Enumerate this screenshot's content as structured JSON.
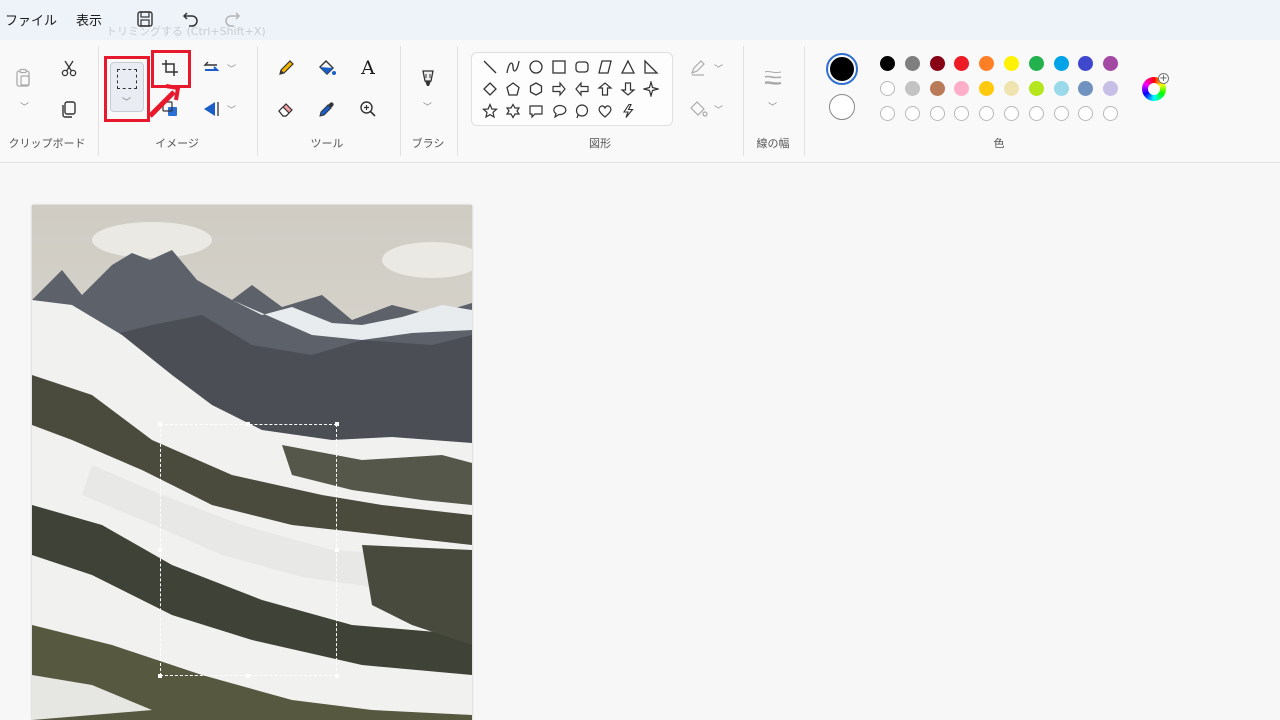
{
  "menu": {
    "file": "ファイル",
    "view": "表示"
  },
  "tooltip": "トリミングする (Ctrl+Shift+X)",
  "groups": {
    "clipboard": "クリップボード",
    "image": "イメージ",
    "tools": "ツール",
    "brushes": "ブラシ",
    "shapes": "図形",
    "line_width": "線の幅",
    "colors": "色"
  },
  "text_tool_glyph": "A",
  "palette": {
    "row1": [
      "#000000",
      "#7f7f7f",
      "#880015",
      "#ed1c24",
      "#ff7f27",
      "#fff200",
      "#22b14c",
      "#00a2e8",
      "#3f48cc",
      "#a349a4"
    ],
    "row2": [
      "#ffffff",
      "#c3c3c3",
      "#b97a57",
      "#ffaec9",
      "#ffc90e",
      "#efe4b0",
      "#b5e61d",
      "#99d9ea",
      "#7092be",
      "#c8bfe7"
    ]
  },
  "primary_color": "#000000",
  "secondary_color": "#ffffff",
  "highlight_color": "#e8192c"
}
